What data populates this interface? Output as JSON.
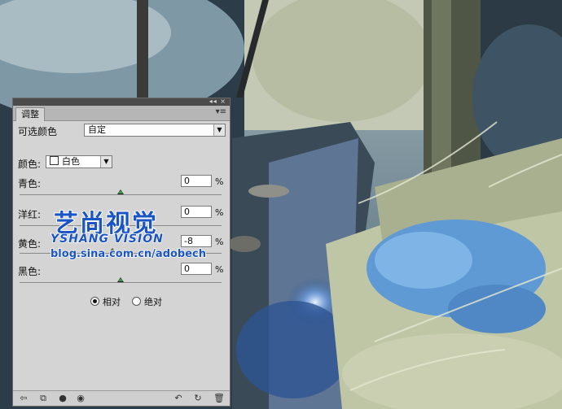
{
  "panel": {
    "tab_label": "调整",
    "topbar_buttons": "◂◂ ×",
    "menu_icon": "panel-menu-icon",
    "preset_label": "可选颜色",
    "preset_value": "自定",
    "color_label": "颜色:",
    "color_value": "白色",
    "sliders": [
      {
        "label": "青色:",
        "value": "0",
        "unit": "%",
        "level": 0
      },
      {
        "label": "洋红:",
        "value": "0",
        "unit": "%",
        "level": 0
      },
      {
        "label": "黄色:",
        "value": "-8",
        "unit": "%",
        "level": -8
      },
      {
        "label": "黑色:",
        "value": "0",
        "unit": "%",
        "level": 0
      }
    ],
    "method": {
      "relative": "相对",
      "absolute": "绝对",
      "selected": "relative"
    },
    "bottom_icons": [
      "back-arrow-icon",
      "clip-layer-icon",
      "toggle-visibility-icon",
      "eye-icon",
      "previous-state-icon",
      "reset-icon",
      "trash-icon"
    ]
  },
  "watermark": {
    "title": "艺尚视觉",
    "subtitle": "YSHANG VISION",
    "url": "blog.sina.com.cn/adobech"
  }
}
